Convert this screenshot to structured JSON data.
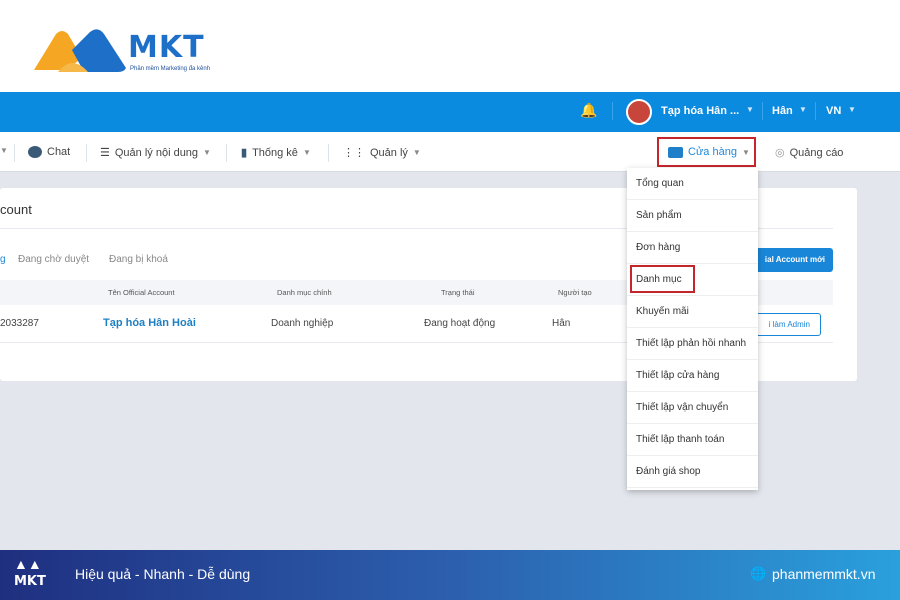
{
  "brand": {
    "logo_text": "MKT",
    "logo_tagline": "Phần mềm Marketing đa kênh",
    "colors": {
      "primary": "#0a8be0",
      "highlight": "#c4262e"
    }
  },
  "topbar": {
    "shop": "Tạp hóa Hân ...",
    "user": "Hân",
    "lang": "VN",
    "bell_icon": "bell-icon"
  },
  "nav": {
    "chat": "Chat",
    "content": "Quản lý nội dung",
    "stats": "Thống kê",
    "manage": "Quản lý",
    "store": "Cửa hàng",
    "ads": "Quảng cáo"
  },
  "card": {
    "title": "count",
    "tabs": [
      "g",
      "Đang chờ duyệt",
      "Đang bị khoá"
    ],
    "new_button": "ial Account mới",
    "columns": [
      "Tên Official Account",
      "Danh mục chính",
      "Trạng thái",
      "Người tạo"
    ],
    "row": {
      "id": "2033287",
      "name": "Tạp hóa Hân Hoài",
      "category": "Doanh nghiệp",
      "status": "Đang hoạt động",
      "creator": "Hân",
      "action": "i làm Admin"
    }
  },
  "dropdown": [
    "Tổng quan",
    "Sản phẩm",
    "Đơn hàng",
    "Danh mục",
    "Khuyến mãi",
    "Thiết lập phản hồi nhanh",
    "Thiết lập cửa hàng",
    "Thiết lập vận chuyển",
    "Thiết lập thanh toán",
    "Đánh giá shop"
  ],
  "footer": {
    "logo_text": "MKT",
    "slogan": "Hiệu quả - Nhanh  - Dễ dùng",
    "website": "phanmemmkt.vn"
  }
}
